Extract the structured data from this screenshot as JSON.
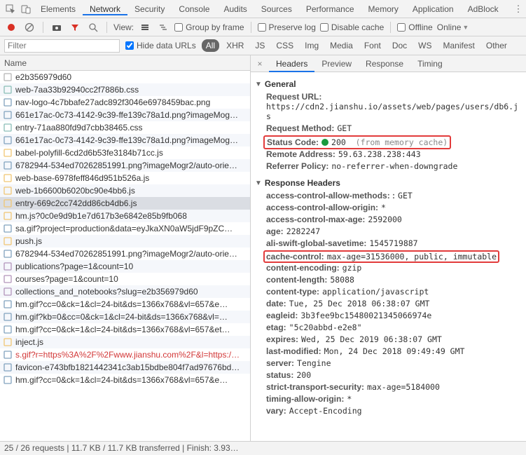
{
  "top_tabs": {
    "items": [
      "Elements",
      "Network",
      "Security",
      "Console",
      "Audits",
      "Sources",
      "Performance",
      "Memory",
      "Application",
      "AdBlock"
    ],
    "active_index": 1
  },
  "toolbar": {
    "view_label": "View:",
    "group_by_frame": "Group by frame",
    "preserve_log": "Preserve log",
    "disable_cache": "Disable cache",
    "offline": "Offline",
    "online": "Online"
  },
  "filter": {
    "placeholder": "Filter",
    "hide_data_urls": "Hide data URLs",
    "types": [
      "All",
      "XHR",
      "JS",
      "CSS",
      "Img",
      "Media",
      "Font",
      "Doc",
      "WS",
      "Manifest",
      "Other"
    ],
    "types_active_index": 0
  },
  "left": {
    "header": "Name",
    "items": [
      {
        "name": "e2b356979d60",
        "icon": "doc"
      },
      {
        "name": "web-7aa33b92940cc2f7886b.css",
        "icon": "css"
      },
      {
        "name": "nav-logo-4c7bbafe27adc892f3046e6978459bac.png",
        "icon": "img"
      },
      {
        "name": "661e17ac-0c73-4142-9c39-ffe139c78a1d.png?imageMog…",
        "icon": "img"
      },
      {
        "name": "entry-71aa880fd9d7cbb38465.css",
        "icon": "css"
      },
      {
        "name": "661e17ac-0c73-4142-9c39-ffe139c78a1d.png?imageMog…",
        "icon": "img"
      },
      {
        "name": "babel-polyfill-6cd2d6b53fe3184b71cc.js",
        "icon": "js"
      },
      {
        "name": "6782944-534ed70262851991.png?imageMogr2/auto-orie…",
        "icon": "img"
      },
      {
        "name": "web-base-6978feff846d951b526a.js",
        "icon": "js"
      },
      {
        "name": "web-1b6600b6020bc90e4bb6.js",
        "icon": "js"
      },
      {
        "name": "entry-669c2cc742dd86cb4db6.js",
        "icon": "js",
        "selected": true
      },
      {
        "name": "hm.js?0c0e9d9b1e7d617b3e6842e85b9fb068",
        "icon": "js"
      },
      {
        "name": "sa.gif?project=production&data=eyJkaXN0aW5jdF9pZC…",
        "icon": "img"
      },
      {
        "name": "push.js",
        "icon": "js"
      },
      {
        "name": "6782944-534ed70262851991.png?imageMogr2/auto-orie…",
        "icon": "img"
      },
      {
        "name": "publications?page=1&count=10",
        "icon": "xhr"
      },
      {
        "name": "courses?page=1&count=10",
        "icon": "xhr"
      },
      {
        "name": "collections_and_notebooks?slug=e2b356979d60",
        "icon": "xhr"
      },
      {
        "name": "hm.gif?cc=0&ck=1&cl=24-bit&ds=1366x768&vl=657&e…",
        "icon": "img"
      },
      {
        "name": "hm.gif?kb=0&cc=0&ck=1&cl=24-bit&ds=1366x768&vl=…",
        "icon": "img"
      },
      {
        "name": "hm.gif?cc=0&ck=1&cl=24-bit&ds=1366x768&vl=657&et…",
        "icon": "img"
      },
      {
        "name": "inject.js",
        "icon": "js"
      },
      {
        "name": "s.gif?r=https%3A%2F%2Fwww.jianshu.com%2F&l=https:/…",
        "icon": "img",
        "red": true
      },
      {
        "name": "favicon-e743bfb1821442341c3ab15bdbe804f7ad97676bd…",
        "icon": "img"
      },
      {
        "name": "hm.gif?cc=0&ck=1&cl=24-bit&ds=1366x768&vl=657&e…",
        "icon": "img"
      }
    ]
  },
  "detail": {
    "tabs": [
      "Headers",
      "Preview",
      "Response",
      "Timing"
    ],
    "active_index": 0,
    "general_title": "General",
    "general": {
      "request_url_k": "Request URL:",
      "request_url_v": "https://cdn2.jianshu.io/assets/web/pages/users/db6.js",
      "request_method_k": "Request Method:",
      "request_method_v": "GET",
      "status_code_k": "Status Code:",
      "status_code_v": "200",
      "status_code_extra": "(from memory cache)",
      "remote_addr_k": "Remote Address:",
      "remote_addr_v": "59.63.238.238:443",
      "referrer_k": "Referrer Policy:",
      "referrer_v": "no-referrer-when-downgrade"
    },
    "resp_title": "Response Headers",
    "resp": [
      {
        "k": "access-control-allow-methods: :",
        "v": "GET"
      },
      {
        "k": "access-control-allow-origin:",
        "v": "*"
      },
      {
        "k": "access-control-max-age:",
        "v": "2592000"
      },
      {
        "k": "age:",
        "v": "2282247"
      },
      {
        "k": "ali-swift-global-savetime:",
        "v": "1545719887"
      },
      {
        "k": "cache-control:",
        "v": "max-age=31536000, public, immutable",
        "hilite": true
      },
      {
        "k": "content-encoding:",
        "v": "gzip"
      },
      {
        "k": "content-length:",
        "v": "58088"
      },
      {
        "k": "content-type:",
        "v": "application/javascript"
      },
      {
        "k": "date:",
        "v": "Tue, 25 Dec 2018 06:38:07 GMT"
      },
      {
        "k": "eagleid:",
        "v": "3b3fee9bc15480021345066974e"
      },
      {
        "k": "etag:",
        "v": "\"5c20abbd-e2e8\""
      },
      {
        "k": "expires:",
        "v": "Wed, 25 Dec 2019 06:38:07 GMT"
      },
      {
        "k": "last-modified:",
        "v": "Mon, 24 Dec 2018 09:49:49 GMT"
      },
      {
        "k": "server:",
        "v": "Tengine"
      },
      {
        "k": "status:",
        "v": "200"
      },
      {
        "k": "strict-transport-security:",
        "v": "max-age=5184000"
      },
      {
        "k": "timing-allow-origin:",
        "v": "*"
      },
      {
        "k": "vary:",
        "v": "Accept-Encoding"
      }
    ]
  },
  "footer": "25 / 26 requests  |  11.7 KB / 11.7 KB transferred  |  Finish: 3.93…"
}
